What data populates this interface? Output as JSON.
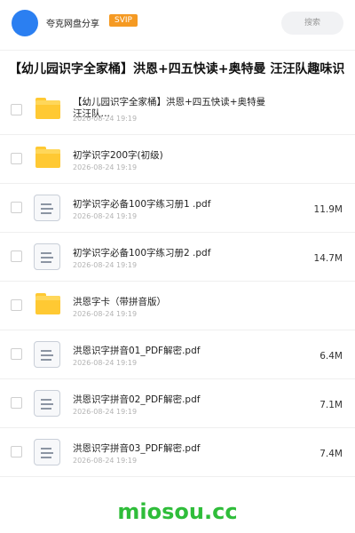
{
  "header": {
    "brand": "夸克网盘分享",
    "vip_badge": "SVIP",
    "search_placeholder": "搜索"
  },
  "folder_title": "【幼儿园识字全家桶】洪恩+四五快读+奥特曼 汪汪队趣味识",
  "files": [
    {
      "type": "folder",
      "name": "【幼儿园识字全家桶】洪恩+四五快读+奥特曼 汪汪队…",
      "date": "2026-08-24 19:19",
      "size": ""
    },
    {
      "type": "folder",
      "name": "初学识字200字(初级)",
      "date": "2026-08-24 19:19",
      "size": ""
    },
    {
      "type": "file",
      "name": "初学识字必备100字练习册1 .pdf",
      "date": "2026-08-24 19:19",
      "size": "11.9M"
    },
    {
      "type": "file",
      "name": "初学识字必备100字练习册2 .pdf",
      "date": "2026-08-24 19:19",
      "size": "14.7M"
    },
    {
      "type": "folder",
      "name": "洪恩字卡（带拼音版）",
      "date": "2026-08-24 19:19",
      "size": ""
    },
    {
      "type": "file",
      "name": "洪恩识字拼音01_PDF解密.pdf",
      "date": "2026-08-24 19:19",
      "size": "6.4M"
    },
    {
      "type": "file",
      "name": "洪恩识字拼音02_PDF解密.pdf",
      "date": "2026-08-24 19:19",
      "size": "7.1M"
    },
    {
      "type": "file",
      "name": "洪恩识字拼音03_PDF解密.pdf",
      "date": "2026-08-24 19:19",
      "size": "7.4M"
    }
  ],
  "watermark": "miosou.cc",
  "colors": {
    "accent": "#2b7ff1",
    "vip": "#f59a23",
    "folder": "#ffc933",
    "watermark": "#2fbd3a"
  }
}
